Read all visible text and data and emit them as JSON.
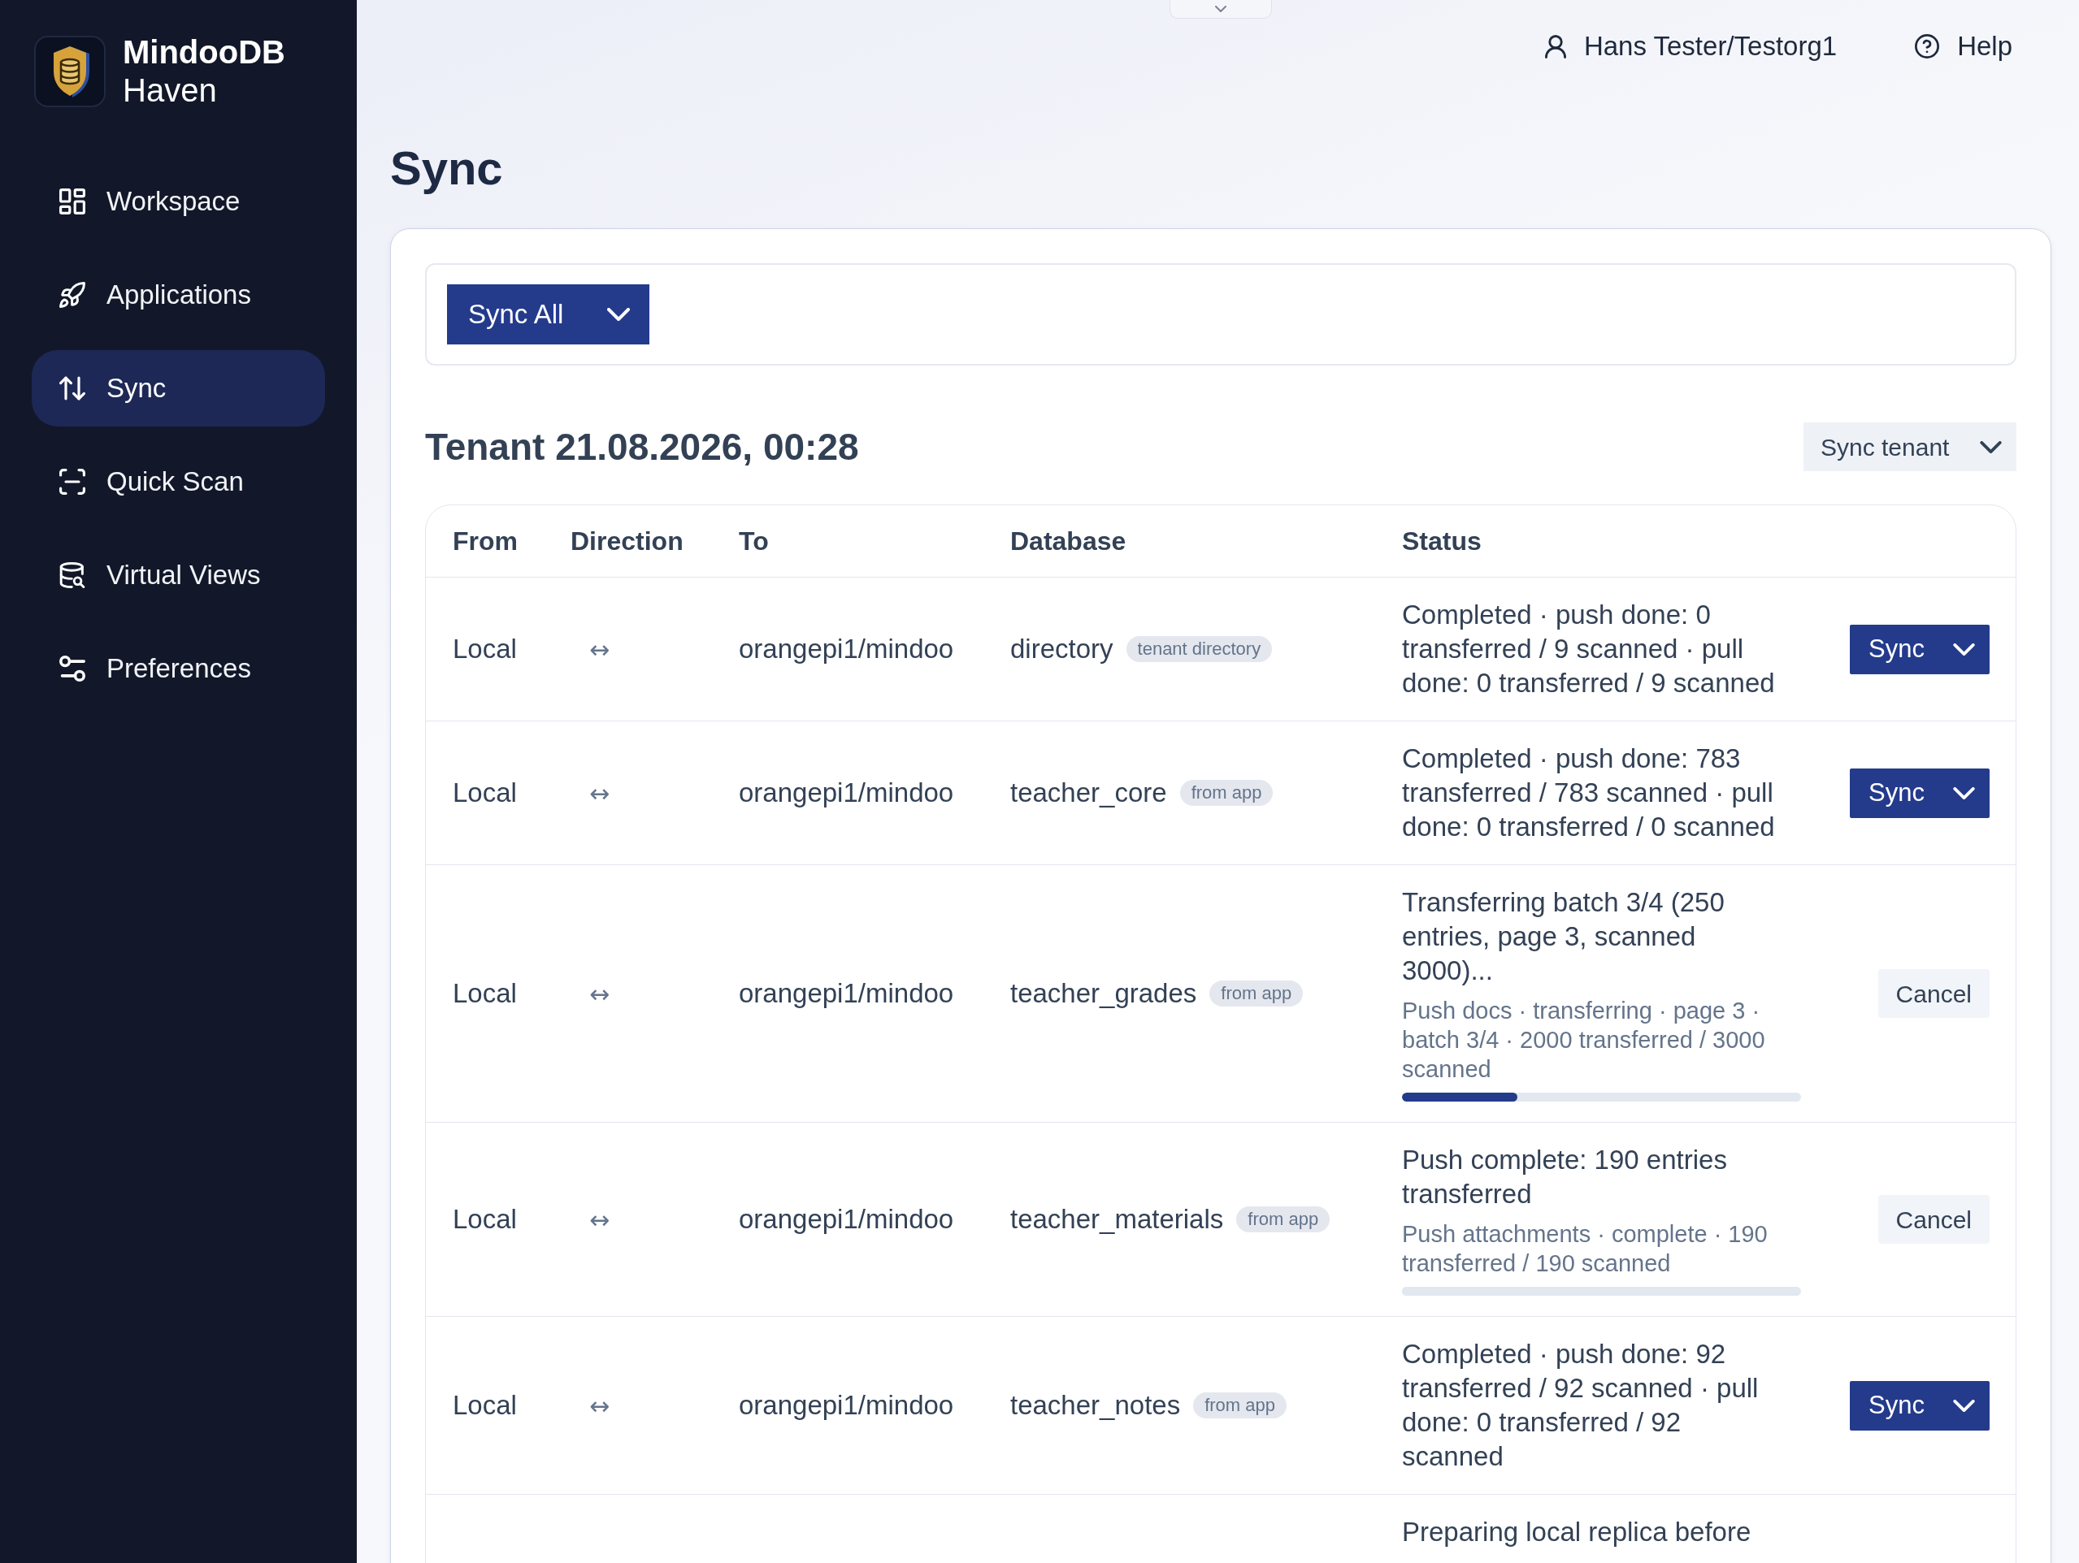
{
  "app": {
    "name": "MindooDB",
    "subtitle": "Haven"
  },
  "sidebar": {
    "items": [
      {
        "label": "Workspace",
        "selected": false
      },
      {
        "label": "Applications",
        "selected": false
      },
      {
        "label": "Sync",
        "selected": true
      },
      {
        "label": "Quick Scan",
        "selected": false
      },
      {
        "label": "Virtual Views",
        "selected": false
      },
      {
        "label": "Preferences",
        "selected": false
      }
    ]
  },
  "header": {
    "user": "Hans Tester/Testorg1",
    "help": "Help"
  },
  "page_title": "Sync",
  "toolbar": {
    "sync_all": "Sync All"
  },
  "tenant": {
    "title": "Tenant 21.08.2026, 00:28",
    "action": "Sync tenant"
  },
  "table": {
    "columns": [
      "From",
      "Direction",
      "To",
      "Database",
      "Status"
    ],
    "rows": [
      {
        "from": "Local",
        "direction": "↔",
        "to": "orangepi1/mindoo",
        "database": "directory",
        "badge": "tenant directory",
        "status": "Completed · push done: 0 transferred / 9 scanned · pull done: 0 transferred / 9 scanned",
        "action": {
          "kind": "sync",
          "label": "Sync"
        }
      },
      {
        "from": "Local",
        "direction": "↔",
        "to": "orangepi1/mindoo",
        "database": "teacher_core",
        "badge": "from app",
        "status": "Completed · push done: 783 transferred / 783 scanned · pull done: 0 transferred / 0 scanned",
        "action": {
          "kind": "sync",
          "label": "Sync"
        }
      },
      {
        "from": "Local",
        "direction": "↔",
        "to": "orangepi1/mindoo",
        "database": "teacher_grades",
        "badge": "from app",
        "status": "Transferring batch 3/4 (250 entries, page 3, scanned 3000)...",
        "detail": "Push docs · transferring · page 3 · batch 3/4 · 2000 transferred / 3000 scanned",
        "level": 0.29,
        "action": {
          "kind": "cancel",
          "label": "Cancel"
        }
      },
      {
        "from": "Local",
        "direction": "↔",
        "to": "orangepi1/mindoo",
        "database": "teacher_materials",
        "badge": "from app",
        "status": "Push complete: 190 entries transferred",
        "detail": "Push attachments · complete · 190 transferred / 190 scanned",
        "level": 0,
        "action": {
          "kind": "cancel",
          "label": "Cancel"
        }
      },
      {
        "from": "Local",
        "direction": "↔",
        "to": "orangepi1/mindoo",
        "database": "teacher_notes",
        "badge": "from app",
        "status": "Completed · push done: 92 transferred / 92 scanned · pull done: 0 transferred / 92 scanned",
        "action": {
          "kind": "sync",
          "label": "Sync"
        }
      },
      {
        "status": "Preparing local replica before"
      }
    ]
  }
}
